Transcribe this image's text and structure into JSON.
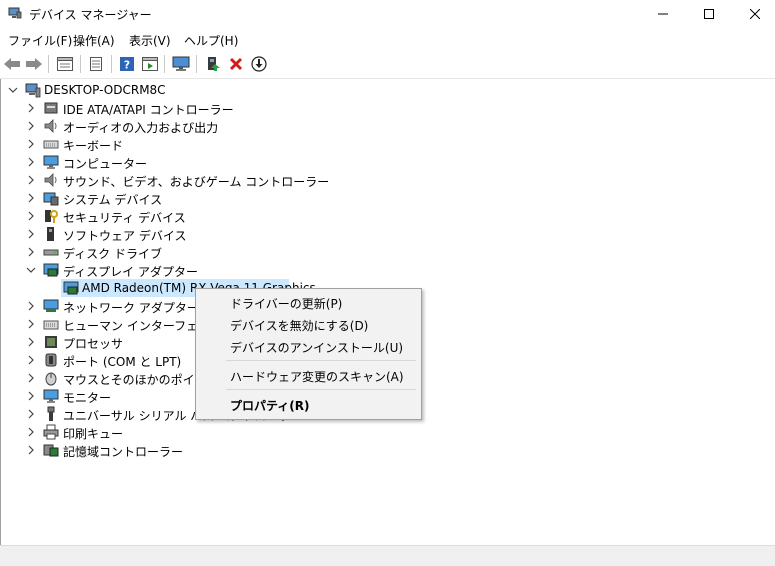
{
  "window": {
    "title": "デバイス マネージャー"
  },
  "menu": [
    "ファイル(F)",
    "操作(A)",
    "表示(V)",
    "ヘルプ(H)"
  ],
  "toolbar": {
    "icons": [
      "back-icon",
      "forward-icon",
      "properties-icon",
      "properties-sheet-icon",
      "help-icon",
      "action-pane-icon",
      "monitor-icon",
      "update-driver-icon",
      "uninstall-icon",
      "download-icon"
    ]
  },
  "tree": {
    "root": "DESKTOP-ODCRM8C",
    "items": [
      {
        "label": "IDE ATA/ATAPI コントローラー",
        "icon": "ide-icon",
        "expanded": false
      },
      {
        "label": "オーディオの入力および出力",
        "icon": "speaker-icon",
        "expanded": false
      },
      {
        "label": "キーボード",
        "icon": "keyboard-icon",
        "expanded": false
      },
      {
        "label": "コンピューター",
        "icon": "computer-icon",
        "expanded": false
      },
      {
        "label": "サウンド、ビデオ、およびゲーム コントローラー",
        "icon": "speaker-icon",
        "expanded": false
      },
      {
        "label": "システム デバイス",
        "icon": "system-icon",
        "expanded": false
      },
      {
        "label": "セキュリティ デバイス",
        "icon": "security-icon",
        "expanded": false
      },
      {
        "label": "ソフトウェア デバイス",
        "icon": "software-icon",
        "expanded": false
      },
      {
        "label": "ディスク ドライブ",
        "icon": "disk-icon",
        "expanded": false
      },
      {
        "label": "ディスプレイ アダプター",
        "icon": "display-adapter-icon",
        "expanded": true
      },
      {
        "label": "AMD Radeon(TM) RX Vega 11 Graphics",
        "icon": "display-adapter-icon",
        "child": true,
        "selected": true
      },
      {
        "label": "ネットワーク アダプター",
        "icon": "network-icon",
        "expanded": false
      },
      {
        "label": "ヒューマン インターフェイス デバイス",
        "icon": "hid-icon",
        "expanded": false
      },
      {
        "label": "プロセッサ",
        "icon": "processor-icon",
        "expanded": false
      },
      {
        "label": "ポート (COM と LPT)",
        "icon": "port-icon",
        "expanded": false
      },
      {
        "label": "マウスとそのほかのポインティング デバイス",
        "icon": "mouse-icon",
        "expanded": false
      },
      {
        "label": "モニター",
        "icon": "monitor-icon",
        "expanded": false
      },
      {
        "label": "ユニバーサル シリアル バス コントローラー",
        "icon": "usb-icon",
        "expanded": false
      },
      {
        "label": "印刷キュー",
        "icon": "printer-icon",
        "expanded": false
      },
      {
        "label": "記憶域コントローラー",
        "icon": "storage-icon",
        "expanded": false
      }
    ]
  },
  "context_menu": {
    "update_driver": "ドライバーの更新(P)",
    "disable_device": "デバイスを無効にする(D)",
    "uninstall_device": "デバイスのアンインストール(U)",
    "scan_hardware": "ハードウェア変更のスキャン(A)",
    "properties": "プロパティ(R)"
  }
}
